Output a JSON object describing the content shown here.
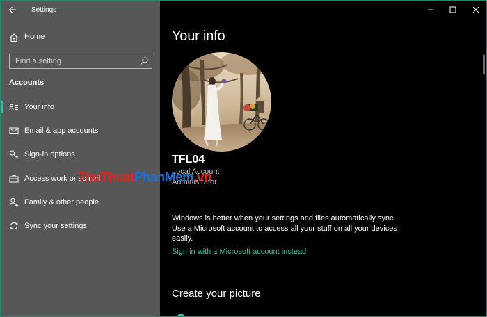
{
  "window": {
    "title": "Settings",
    "accent": "#2ec4a0",
    "sidebar_bg": "#575757",
    "content_bg": "#000000"
  },
  "sidebar": {
    "home_label": "Home",
    "search_placeholder": "Find a setting",
    "section_header": "Accounts",
    "items": [
      {
        "label": "Your info",
        "icon": "person-card-icon",
        "active": true
      },
      {
        "label": "Email & app accounts",
        "icon": "mail-icon",
        "active": false
      },
      {
        "label": "Sign-in options",
        "icon": "key-icon",
        "active": false
      },
      {
        "label": "Access work or school",
        "icon": "briefcase-icon",
        "active": false
      },
      {
        "label": "Family & other people",
        "icon": "person-add-icon",
        "active": false
      },
      {
        "label": "Sync your settings",
        "icon": "sync-icon",
        "active": false
      }
    ]
  },
  "main": {
    "title": "Your info",
    "user": {
      "name": "TFL04",
      "account_type": "Local Account",
      "role": "Administrator"
    },
    "sync_message": "Windows is better when your settings and files automatically sync. Use a Microsoft account to access all your stuff on all your devices easily.",
    "link_label": "Sign in with a Microsoft account instead",
    "section_title": "Create your picture"
  },
  "watermark": {
    "part1": "ThuThuat",
    "part2": "PhanMem",
    "part3": ".vn"
  }
}
